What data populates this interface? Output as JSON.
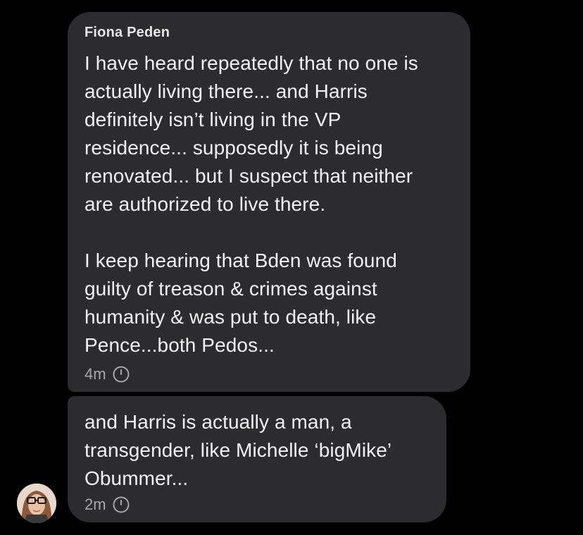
{
  "thread": {
    "messages": [
      {
        "sender": "Fiona Peden",
        "text": "I have heard repeatedly that no one is\nactually living there... and Harris\ndefinitely isn’t living in the VP\nresidence... supposedly it is being\nrenovated... but I suspect that neither\nare authorized to live there.\n\nI keep hearing that Bden was found\nguilty of treason & crimes against\nhumanity & was put to death, like\nPence...both Pedos...",
        "time": "4m",
        "time_icon": "clock-icon"
      },
      {
        "text": "and Harris is actually a man, a\ntransgender, like Michelle ‘bigMike’\nObummer...",
        "time": "2m",
        "time_icon": "clock-icon"
      }
    ],
    "avatar_icon": "avatar"
  },
  "colors": {
    "background": "#000000",
    "bubble": "#2c2c2e",
    "text": "#f2f2f2",
    "meta": "#a8a8a8"
  }
}
